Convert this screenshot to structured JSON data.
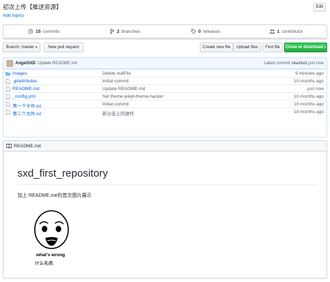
{
  "repo": {
    "description": "初次上传【推送资源】",
    "add_topics": "Add topics",
    "edit_label": "Edit"
  },
  "summary": {
    "commits_count": "15",
    "commits_label": "commits",
    "branches_count": "2",
    "branches_label": "branches",
    "releases_count": "0",
    "releases_label": "releases",
    "contributors_count": "1",
    "contributors_label": "contributor"
  },
  "toolbar": {
    "branch_label": "Branch: master",
    "new_pr": "New pull request",
    "create_file": "Create new file",
    "upload_files": "Upload files",
    "find_file": "Find file",
    "clone": "Clone or download"
  },
  "commit": {
    "author": "AngelSXD",
    "message": "Update README.md",
    "latest_label": "Latest commit",
    "sha": "14a16d2",
    "age": "just now"
  },
  "files": [
    {
      "name": "images",
      "type": "dir",
      "message": "Delete nullFile",
      "age": "9 minutes ago"
    },
    {
      "name": ".gitattributes",
      "type": "file",
      "message": "Initial commit",
      "age": "10 months ago"
    },
    {
      "name": "README.md",
      "type": "file",
      "message": "Update README.md",
      "age": "just now"
    },
    {
      "name": "_config.yml",
      "type": "file",
      "message": "Set theme jekyll-theme-hacker",
      "age": "10 months ago"
    },
    {
      "name": "第一个文件.txt",
      "type": "file",
      "message": "Initial commit",
      "age": "10 months ago"
    },
    {
      "name": "第二个文件.txt",
      "type": "file",
      "message": "新分支上的操作",
      "age": "10 months ago"
    }
  ],
  "readme": {
    "header": "README.md",
    "title": "sxd_first_repository",
    "paragraph": "加上 README.me的首次图片展示",
    "meme_caption_en": "what's wrong",
    "meme_caption_cn": "什么毛病"
  },
  "colors": {
    "link": "#0366d6",
    "green": "#28a745",
    "commit_bg": "#f1f8ff"
  }
}
